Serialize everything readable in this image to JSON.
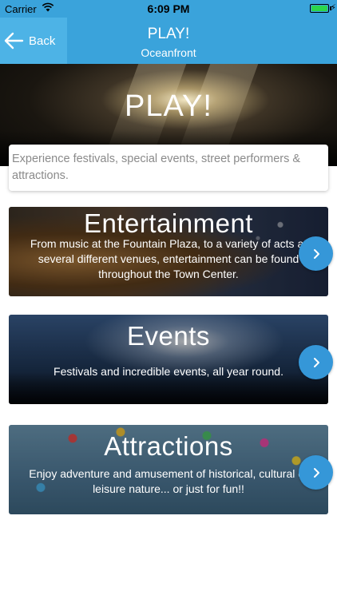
{
  "status_bar": {
    "carrier": "Carrier",
    "time": "6:09 PM",
    "battery_level": 1.0
  },
  "nav": {
    "back_label": "Back",
    "title": "PLAY!",
    "subtitle": "Oceanfront"
  },
  "hero": {
    "title": "PLAY!",
    "intro": "Experience festivals, special events, street performers & attractions."
  },
  "cards": [
    {
      "title": "Entertainment",
      "description": "From music at the Fountain Plaza, to a variety of acts at several different venues, entertainment can be found throughout the Town Center.",
      "icon": "chevron-right-icon"
    },
    {
      "title": "Events",
      "description": "Festivals and incredible events, all year round.",
      "icon": "chevron-right-icon"
    },
    {
      "title": "Attractions",
      "description": "Enjoy adventure and amusement of historical, cultural or leisure nature... or just for fun!!",
      "icon": "chevron-right-icon"
    }
  ],
  "colors": {
    "nav_bar": "#3aa3db",
    "back_button": "#4db3e6",
    "arrow_button": "#3597d8"
  }
}
